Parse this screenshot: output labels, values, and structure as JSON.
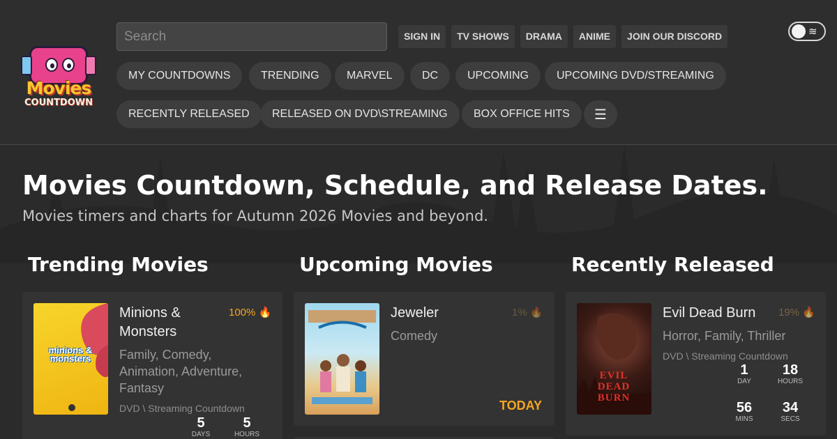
{
  "search": {
    "placeholder": "Search"
  },
  "topnav": [
    "SIGN IN",
    "TV SHOWS",
    "DRAMA",
    "ANIME",
    "JOIN OUR DISCORD"
  ],
  "nav_row1": [
    "MY COUNTDOWNS",
    "TRENDING",
    "MARVEL",
    "DC",
    "UPCOMING",
    "UPCOMING DVD/STREAMING"
  ],
  "nav_row2": [
    "RECENTLY RELEASED",
    "RELEASED ON DVD\\STREAMING",
    "BOX OFFICE HITS"
  ],
  "logo": {
    "line1": "Movies",
    "line2": "COUNTDOWN"
  },
  "hero": {
    "title": "Movies Countdown, Schedule, and Release Dates.",
    "subtitle": "Movies timers and charts for Autumn 2026 Movies and beyond."
  },
  "sections": {
    "trending": {
      "title": "Trending Movies",
      "movie": {
        "name": "Minions & Monsters",
        "percent": "100%",
        "genres": "Family, Comedy, Animation, Adventure, Fantasy",
        "type": "DVD \\ Streaming Countdown",
        "poster_text": "minions & monsters",
        "countdown": [
          {
            "num": "5",
            "label": "DAYS"
          },
          {
            "num": "5",
            "label": "HOURS"
          }
        ]
      }
    },
    "upcoming": {
      "title": "Upcoming Movies",
      "movie": {
        "name": "Jeweler",
        "percent": "1%",
        "genres": "Comedy",
        "status": "TODAY"
      }
    },
    "recent": {
      "title": "Recently Released",
      "movie": {
        "name": "Evil Dead Burn",
        "percent": "19%",
        "genres": "Horror, Family, Thriller",
        "type": "DVD \\ Streaming Countdown",
        "poster_text": "EVIL DEAD BURN",
        "countdown": [
          {
            "num": "1",
            "label": "DAY"
          },
          {
            "num": "18",
            "label": "HOURS"
          },
          {
            "num": "56",
            "label": "MINS"
          },
          {
            "num": "34",
            "label": "SECS"
          }
        ]
      }
    }
  },
  "icons": {
    "fire": "fire-icon",
    "menu": "hamburger-menu-icon",
    "theme": "dark-mode-toggle"
  },
  "colors": {
    "accent": "#f5a623",
    "background": "#2b2b2b",
    "card": "#333333"
  }
}
